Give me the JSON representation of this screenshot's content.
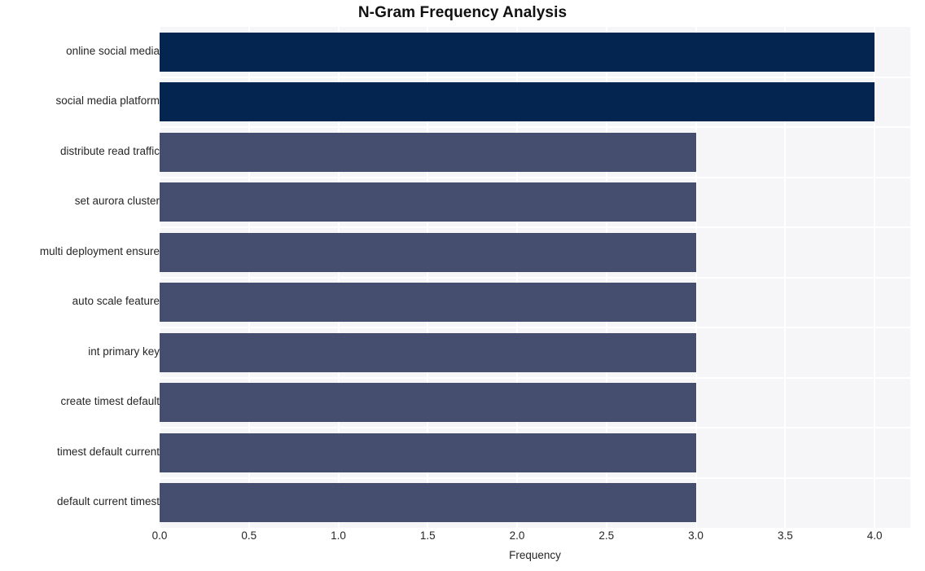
{
  "chart_data": {
    "type": "bar",
    "orientation": "horizontal",
    "title": "N-Gram Frequency Analysis",
    "xlabel": "Frequency",
    "ylabel": "",
    "categories": [
      "online social media",
      "social media platform",
      "distribute read traffic",
      "set aurora cluster",
      "multi deployment ensure",
      "auto scale feature",
      "int primary key",
      "create timest default",
      "timest default current",
      "default current timest"
    ],
    "values": [
      4,
      4,
      3,
      3,
      3,
      3,
      3,
      3,
      3,
      3
    ],
    "bar_colors": [
      "#03254f",
      "#03254f",
      "#454e6e",
      "#454e6e",
      "#454e6e",
      "#454e6e",
      "#454e6e",
      "#454e6e",
      "#454e6e",
      "#454e6e"
    ],
    "xlim": [
      0,
      4.2
    ],
    "xticks": [
      0.0,
      0.5,
      1.0,
      1.5,
      2.0,
      2.5,
      3.0,
      3.5,
      4.0
    ],
    "xticklabels": [
      "0.0",
      "0.5",
      "1.0",
      "1.5",
      "2.0",
      "2.5",
      "3.0",
      "3.5",
      "4.0"
    ],
    "grid": true,
    "grid_color": "#ffffff",
    "plot_background": "#f6f6f8",
    "figure_background": "#ffffff",
    "legend": null
  }
}
